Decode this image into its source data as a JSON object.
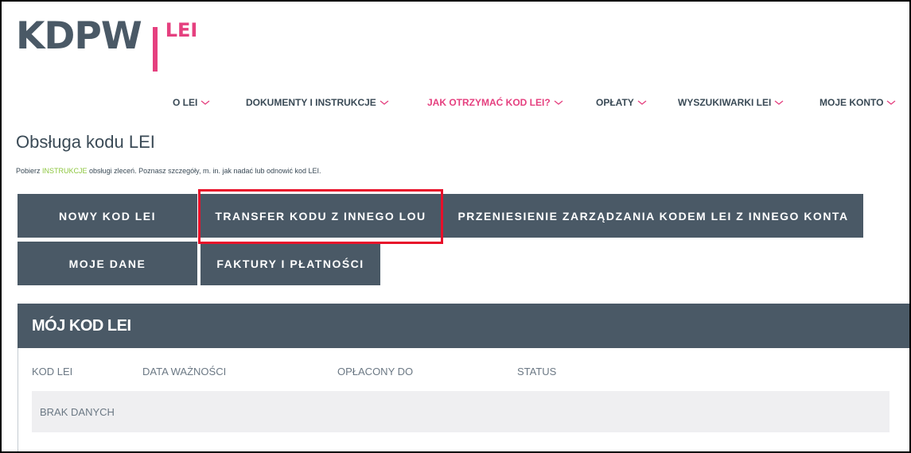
{
  "brand": {
    "name": "KDPW",
    "suffix": "LEI"
  },
  "nav": {
    "items": [
      {
        "label": "O LEI"
      },
      {
        "label": "DOKUMENTY I INSTRUKCJE"
      },
      {
        "label": "JAK OTRZYMAĆ KOD LEI?"
      },
      {
        "label": "OPŁATY"
      },
      {
        "label": "WYSZUKIWARKI LEI"
      },
      {
        "label": "MOJE KONTO"
      }
    ],
    "active_index": 2
  },
  "page": {
    "title": "Obsługa kodu LEI",
    "instructions": {
      "before": "Pobierz ",
      "link": "INSTRUKCJE",
      "after": " obsługi zleceń. Poznasz szczegóły, m. in. jak nadać lub odnowić kod LEI."
    }
  },
  "actions": {
    "new_code": "NOWY KOD LEI",
    "transfer": "TRANSFER KODU Z INNEGO LOU",
    "move_management": "PRZENIESIENIE ZARZĄDZANIA KODEM LEI Z INNEGO KONTA",
    "my_data": "MOJE DANE",
    "invoices": "FAKTURY I PŁATNOŚCI"
  },
  "my_code": {
    "title": "MÓJ KOD LEI",
    "columns": [
      "KOD LEI",
      "DATA WAŻNOŚCI",
      "OPŁACONY DO",
      "STATUS"
    ],
    "empty_text": "BRAK DANYCH"
  },
  "colors": {
    "accent": "#e5407f",
    "button_bg": "#4a5966",
    "highlight": "#e8102a",
    "link": "#8cc63e"
  }
}
